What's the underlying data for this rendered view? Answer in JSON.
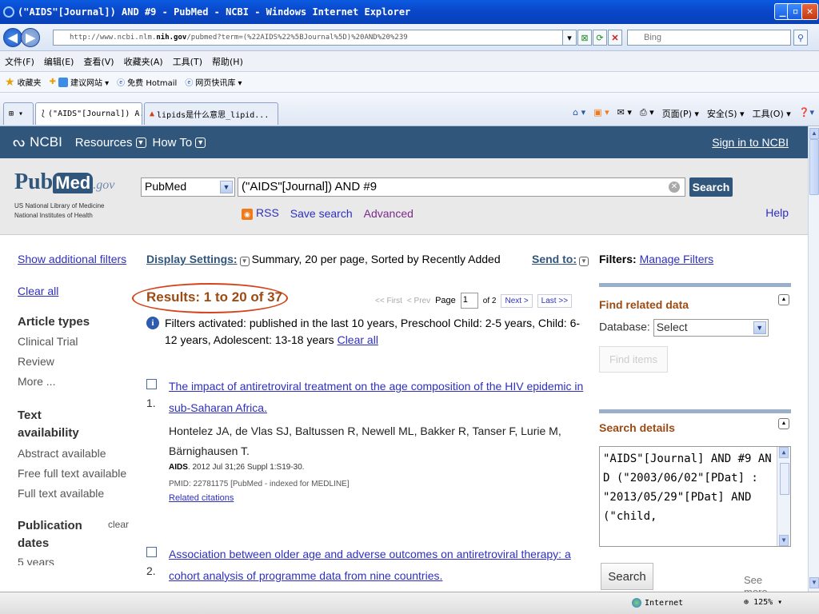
{
  "window": {
    "title": "(\"AIDS\"[Journal]) AND #9 - PubMed - NCBI - Windows Internet Explorer"
  },
  "address": {
    "url_prefix": "http://www.ncbi.nlm.",
    "url_host": "nih.gov",
    "url_rest": "/pubmed?term=(%22AIDS%22%5BJournal%5D)%20AND%20%239",
    "search_placeholder": "Bing"
  },
  "menu": {
    "items": [
      "文件(F)",
      "编辑(E)",
      "查看(V)",
      "收藏夹(A)",
      "工具(T)",
      "帮助(H)"
    ]
  },
  "favorites": {
    "label": "收藏夹",
    "items": [
      "建议网站 ▾",
      "免费 Hotmail",
      "网页快讯库 ▾"
    ]
  },
  "tabs": {
    "active": "(\"AIDS\"[Journal]) A...",
    "other": "lipids是什么意思_lipid...",
    "tools": [
      "页面(P) ▾",
      "安全(S) ▾",
      "工具(O) ▾"
    ]
  },
  "ncbi": {
    "logo": "NCBI",
    "resources": "Resources",
    "howto": "How To",
    "signin": "Sign in to NCBI"
  },
  "search": {
    "logo_pub": "Pub",
    "logo_med": "Med",
    "logo_gov": ".gov",
    "nlm_line1": "US National Library of Medicine",
    "nlm_line2": "National Institutes of Health",
    "database": "PubMed",
    "query": "(\"AIDS\"[Journal]) AND #9",
    "button": "Search",
    "rss": "RSS",
    "save": "Save search",
    "advanced": "Advanced",
    "help": "Help"
  },
  "left": {
    "show_filters": "Show additional filters",
    "clear_all": "Clear all",
    "article_types": "Article types",
    "article_items": [
      "Clinical Trial",
      "Review",
      "More ..."
    ],
    "text_avail": "Text availability",
    "text_items": [
      "Abstract available",
      "Free full text available",
      "Full text available"
    ],
    "pub_dates": "Publication dates",
    "pub_clear": "clear",
    "pub_items": [
      "5 years"
    ]
  },
  "main": {
    "display_settings": "Display Settings:",
    "display_desc": "Summary, 20 per page, Sorted by Recently Added",
    "send_to": "Send to:",
    "results": "Results: 1 to 20 of 37",
    "pager": {
      "first": "<< First",
      "prev": "< Prev",
      "page": "Page",
      "current": "1",
      "of": "of 2",
      "next": "Next >",
      "last": "Last >>"
    },
    "filters_text": "Filters activated: published in the last 10 years, Preschool Child: 2-5 years, Child: 6-12 years, Adolescent: 13-18 years",
    "filters_clear": "Clear all",
    "results_list": [
      {
        "num": "1.",
        "title": "The impact of antiretroviral treatment on the age composition of the HIV epidemic in sub-Saharan Africa.",
        "authors": "Hontelez JA, de Vlas SJ, Baltussen R, Newell ML, Bakker R, Tanser F, Lurie M, Bärnighausen T.",
        "journal": "AIDS",
        "citation": ". 2012 Jul 31;26 Suppl 1:S19-30.",
        "pmid": "PMID: 22781175 [PubMed - indexed for MEDLINE]",
        "related": "Related citations"
      },
      {
        "num": "2.",
        "title": "Association between older age and adverse outcomes on antiretroviral therapy: a cohort analysis of programme data from nine countries."
      }
    ]
  },
  "right": {
    "filters_label": "Filters:",
    "manage": "Manage Filters",
    "find_related": "Find related data",
    "database_label": "Database:",
    "database_value": "Select",
    "find_items": "Find items",
    "search_details": "Search details",
    "details_text": "\"AIDS\"[Journal] AND #9 AND (\"2003/06/02\"[PDat] : \"2013/05/29\"[PDat] AND (\"child,",
    "search_button": "Search",
    "see_more": "See more..."
  },
  "status": {
    "zone": "Internet",
    "zoom": "125%"
  }
}
